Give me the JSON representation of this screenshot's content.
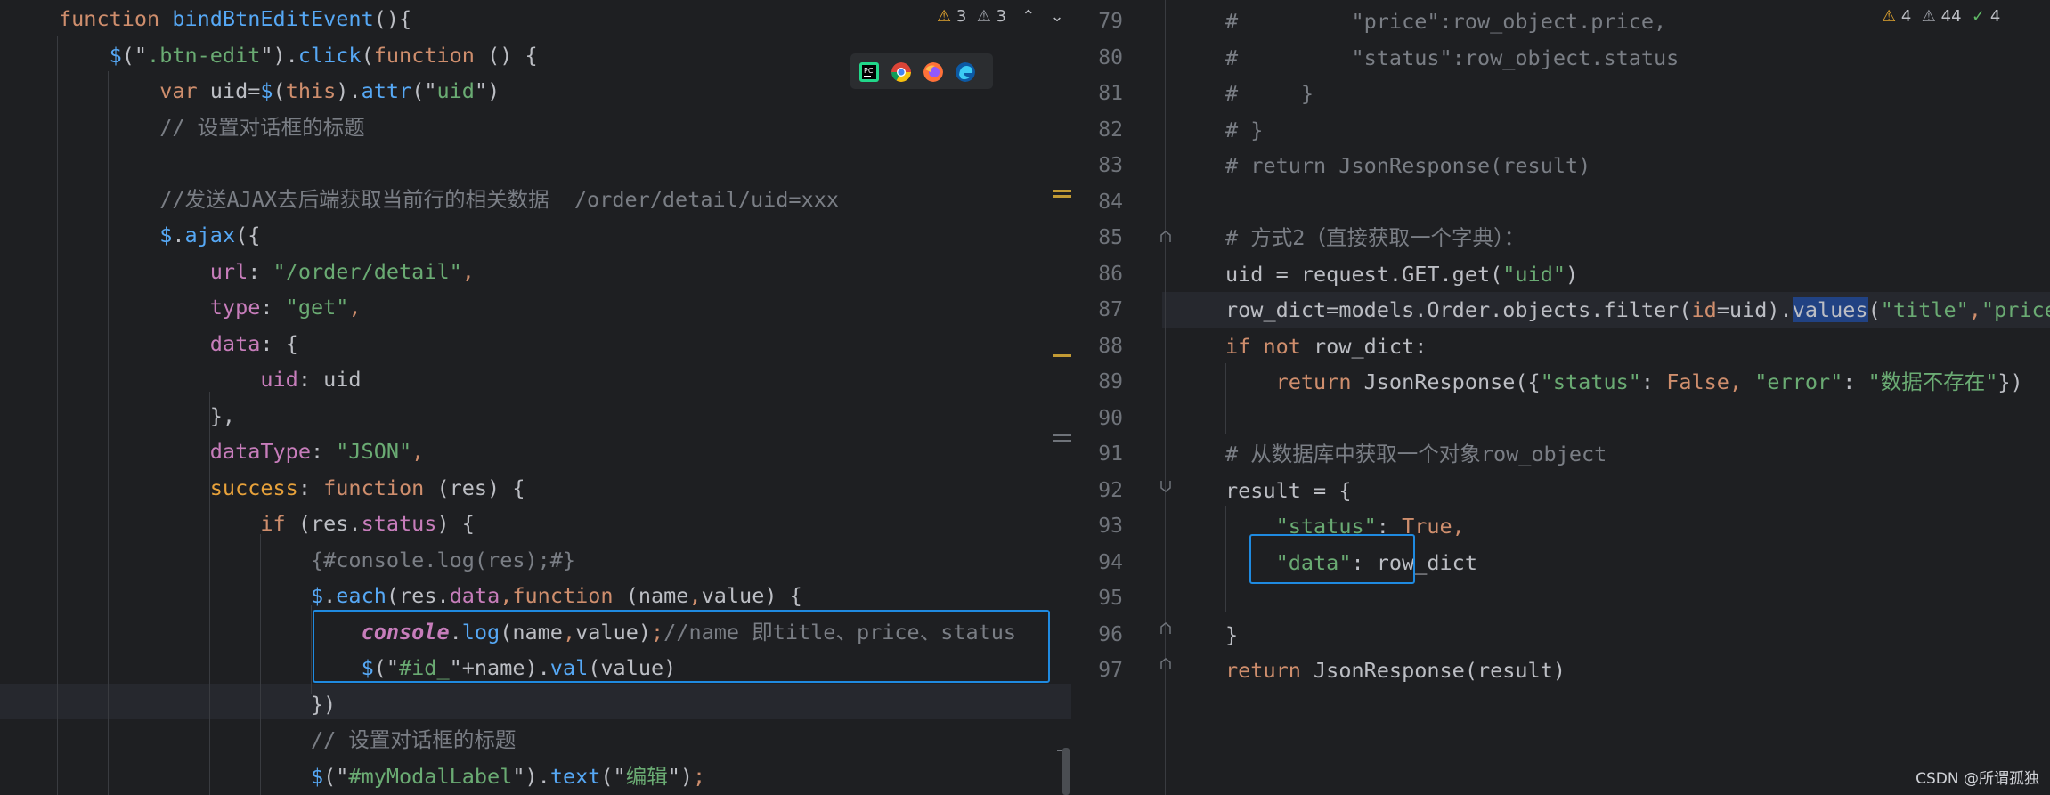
{
  "left_editor": {
    "inspections": {
      "warnings": "3",
      "weak_warnings": "3",
      "up_arrow": "⌃",
      "down_arrow": "⌄"
    },
    "browser_icons": [
      "pycharm-icon",
      "chrome-icon",
      "firefox-icon",
      "edge-icon"
    ],
    "lines": [
      {
        "tokens": [
          {
            "c": "kw",
            "t": "function "
          },
          {
            "c": "fn",
            "t": "bindBtnEditEvent"
          },
          {
            "c": "plain",
            "t": "(){"
          }
        ]
      },
      {
        "tokens": [
          {
            "c": "plain",
            "t": "    "
          },
          {
            "c": "fn",
            "t": "$"
          },
          {
            "c": "plain",
            "t": "(\""
          },
          {
            "c": "str",
            "t": ".btn-edit"
          },
          {
            "c": "plain",
            "t": "\")."
          },
          {
            "c": "fn",
            "t": "click"
          },
          {
            "c": "plain",
            "t": "("
          },
          {
            "c": "kw",
            "t": "function"
          },
          {
            "c": "plain",
            "t": " () {"
          }
        ]
      },
      {
        "tokens": [
          {
            "c": "plain",
            "t": "        "
          },
          {
            "c": "kw",
            "t": "var"
          },
          {
            "c": "plain",
            "t": " uid="
          },
          {
            "c": "fn",
            "t": "$"
          },
          {
            "c": "plain",
            "t": "("
          },
          {
            "c": "kw",
            "t": "this"
          },
          {
            "c": "plain",
            "t": ")."
          },
          {
            "c": "fn",
            "t": "attr"
          },
          {
            "c": "plain",
            "t": "(\""
          },
          {
            "c": "str",
            "t": "uid"
          },
          {
            "c": "plain",
            "t": "\")"
          }
        ]
      },
      {
        "tokens": [
          {
            "c": "plain",
            "t": "        "
          },
          {
            "c": "cm",
            "t": "// 设置对话框的标题"
          }
        ]
      },
      {
        "tokens": []
      },
      {
        "tokens": [
          {
            "c": "plain",
            "t": "        "
          },
          {
            "c": "cm",
            "t": "//发送AJAX去后端获取当前行的相关数据  /order/detail/uid=xxx"
          }
        ]
      },
      {
        "tokens": [
          {
            "c": "plain",
            "t": "        "
          },
          {
            "c": "fn",
            "t": "$"
          },
          {
            "c": "plain",
            "t": "."
          },
          {
            "c": "fn",
            "t": "ajax"
          },
          {
            "c": "plain",
            "t": "({"
          }
        ]
      },
      {
        "tokens": [
          {
            "c": "plain",
            "t": "            "
          },
          {
            "c": "prop",
            "t": "url"
          },
          {
            "c": "plain",
            "t": ": "
          },
          {
            "c": "str",
            "t": "\"/order/detail\""
          },
          {
            "c": "kw",
            "t": ","
          }
        ]
      },
      {
        "tokens": [
          {
            "c": "plain",
            "t": "            "
          },
          {
            "c": "prop",
            "t": "type"
          },
          {
            "c": "plain",
            "t": ": "
          },
          {
            "c": "str",
            "t": "\"get\""
          },
          {
            "c": "kw",
            "t": ","
          }
        ]
      },
      {
        "tokens": [
          {
            "c": "plain",
            "t": "            "
          },
          {
            "c": "prop",
            "t": "data"
          },
          {
            "c": "plain",
            "t": ": {"
          }
        ]
      },
      {
        "tokens": [
          {
            "c": "plain",
            "t": "                "
          },
          {
            "c": "prop",
            "t": "uid"
          },
          {
            "c": "plain",
            "t": ": uid"
          }
        ]
      },
      {
        "tokens": [
          {
            "c": "plain",
            "t": "            },"
          }
        ]
      },
      {
        "tokens": [
          {
            "c": "plain",
            "t": "            "
          },
          {
            "c": "prop",
            "t": "dataType"
          },
          {
            "c": "plain",
            "t": ": "
          },
          {
            "c": "str",
            "t": "\"JSON\""
          },
          {
            "c": "kw",
            "t": ","
          }
        ]
      },
      {
        "tokens": [
          {
            "c": "plain",
            "t": "            "
          },
          {
            "c": "yel",
            "t": "success"
          },
          {
            "c": "plain",
            "t": ": "
          },
          {
            "c": "kw",
            "t": "function"
          },
          {
            "c": "plain",
            "t": " (res) {"
          }
        ]
      },
      {
        "tokens": [
          {
            "c": "plain",
            "t": "                "
          },
          {
            "c": "kw",
            "t": "if"
          },
          {
            "c": "plain",
            "t": " (res."
          },
          {
            "c": "prop",
            "t": "status"
          },
          {
            "c": "plain",
            "t": ") {"
          }
        ]
      },
      {
        "tokens": [
          {
            "c": "plain",
            "t": "                    "
          },
          {
            "c": "cm",
            "t": "{#console.log(res);#}"
          }
        ]
      },
      {
        "tokens": [
          {
            "c": "plain",
            "t": "                    "
          },
          {
            "c": "fn",
            "t": "$"
          },
          {
            "c": "plain",
            "t": "."
          },
          {
            "c": "fn",
            "t": "each"
          },
          {
            "c": "plain",
            "t": "(res."
          },
          {
            "c": "prop",
            "t": "data"
          },
          {
            "c": "kw",
            "t": ","
          },
          {
            "c": "kw",
            "t": "function"
          },
          {
            "c": "plain",
            "t": " (name"
          },
          {
            "c": "kw",
            "t": ","
          },
          {
            "c": "plain",
            "t": "value) {"
          }
        ]
      },
      {
        "tokens": [
          {
            "c": "plain",
            "t": "                        "
          },
          {
            "c": "ital",
            "t": "console"
          },
          {
            "c": "plain",
            "t": "."
          },
          {
            "c": "fn",
            "t": "log"
          },
          {
            "c": "plain",
            "t": "(name"
          },
          {
            "c": "kw",
            "t": ","
          },
          {
            "c": "plain",
            "t": "value)"
          },
          {
            "c": "kw",
            "t": ";"
          },
          {
            "c": "cm",
            "t": "//name 即title、price、status"
          }
        ]
      },
      {
        "tokens": [
          {
            "c": "plain",
            "t": "                        "
          },
          {
            "c": "fn",
            "t": "$"
          },
          {
            "c": "plain",
            "t": "(\""
          },
          {
            "c": "str",
            "t": "#id_"
          },
          {
            "c": "plain",
            "t": "\"+name)."
          },
          {
            "c": "fn",
            "t": "val"
          },
          {
            "c": "plain",
            "t": "(value)"
          }
        ]
      },
      {
        "tokens": [
          {
            "c": "plain",
            "t": "                    })"
          }
        ]
      },
      {
        "tokens": [
          {
            "c": "plain",
            "t": "                    "
          },
          {
            "c": "cm",
            "t": "// 设置对话框的标题"
          }
        ]
      },
      {
        "tokens": [
          {
            "c": "plain",
            "t": "                    "
          },
          {
            "c": "fn",
            "t": "$"
          },
          {
            "c": "plain",
            "t": "(\""
          },
          {
            "c": "str",
            "t": "#myModalLabel"
          },
          {
            "c": "plain",
            "t": "\")."
          },
          {
            "c": "fn",
            "t": "text"
          },
          {
            "c": "plain",
            "t": "(\""
          },
          {
            "c": "str",
            "t": "编辑"
          },
          {
            "c": "plain",
            "t": "\")"
          },
          {
            "c": "kw",
            "t": ";"
          }
        ]
      }
    ]
  },
  "right_editor": {
    "inspections": {
      "warnings": "4",
      "weak_warnings": "44",
      "typos": "4"
    },
    "lines": [
      {
        "num": "79",
        "tokens": [
          {
            "c": "cm",
            "t": "#         \"price\":row_object.price,"
          }
        ]
      },
      {
        "num": "80",
        "tokens": [
          {
            "c": "cm",
            "t": "#         \"status\":row_object.status"
          }
        ]
      },
      {
        "num": "81",
        "tokens": [
          {
            "c": "cm",
            "t": "#     }"
          }
        ]
      },
      {
        "num": "82",
        "tokens": [
          {
            "c": "cm",
            "t": "# }"
          }
        ]
      },
      {
        "num": "83",
        "tokens": [
          {
            "c": "cm",
            "t": "# return JsonResponse(result)"
          }
        ]
      },
      {
        "num": "84",
        "tokens": []
      },
      {
        "num": "85",
        "tokens": [
          {
            "c": "cm",
            "t": "# 方式2（直接获取一个字典）："
          }
        ]
      },
      {
        "num": "86",
        "tokens": [
          {
            "c": "plain",
            "t": "uid = request.GET.get("
          },
          {
            "c": "str",
            "t": "\"uid\""
          },
          {
            "c": "plain",
            "t": ")"
          }
        ]
      },
      {
        "num": "87",
        "tokens": [
          {
            "c": "plain",
            "t": "row_dict=models.Order.objects.filter("
          },
          {
            "c": "kw",
            "t": "id"
          },
          {
            "c": "plain",
            "t": "=uid)."
          },
          {
            "c": "sel",
            "t": "values"
          },
          {
            "c": "plain",
            "t": "("
          },
          {
            "c": "str",
            "t": "\"title\""
          },
          {
            "c": "kw",
            "t": ","
          },
          {
            "c": "str",
            "t": "\"price\""
          }
        ]
      },
      {
        "num": "88",
        "tokens": [
          {
            "c": "kw",
            "t": "if not"
          },
          {
            "c": "plain",
            "t": " row_dict:"
          }
        ]
      },
      {
        "num": "89",
        "tokens": [
          {
            "c": "plain",
            "t": "    "
          },
          {
            "c": "kw",
            "t": "return"
          },
          {
            "c": "plain",
            "t": " JsonResponse({"
          },
          {
            "c": "str",
            "t": "\"status\""
          },
          {
            "c": "plain",
            "t": ": "
          },
          {
            "c": "kw",
            "t": "False"
          },
          {
            "c": "kw",
            "t": ", "
          },
          {
            "c": "str",
            "t": "\"error\""
          },
          {
            "c": "plain",
            "t": ": "
          },
          {
            "c": "str",
            "t": "\"数据不存在\""
          },
          {
            "c": "plain",
            "t": "})"
          }
        ]
      },
      {
        "num": "90",
        "tokens": []
      },
      {
        "num": "91",
        "tokens": [
          {
            "c": "cm",
            "t": "# 从数据库中获取一个对象row_object"
          }
        ]
      },
      {
        "num": "92",
        "tokens": [
          {
            "c": "plain",
            "t": "result = {"
          }
        ]
      },
      {
        "num": "93",
        "tokens": [
          {
            "c": "plain",
            "t": "    "
          },
          {
            "c": "str",
            "t": "\"status\""
          },
          {
            "c": "plain",
            "t": ": "
          },
          {
            "c": "kw",
            "t": "True"
          },
          {
            "c": "kw",
            "t": ","
          }
        ]
      },
      {
        "num": "94",
        "tokens": [
          {
            "c": "plain",
            "t": "    "
          },
          {
            "c": "str",
            "t": "\"data\""
          },
          {
            "c": "plain",
            "t": ": row_dict"
          }
        ]
      },
      {
        "num": "95",
        "tokens": []
      },
      {
        "num": "96",
        "tokens": [
          {
            "c": "plain",
            "t": "}"
          }
        ]
      },
      {
        "num": "97",
        "tokens": [
          {
            "c": "kw",
            "t": "return"
          },
          {
            "c": "plain",
            "t": " JsonResponse(result)"
          }
        ]
      }
    ]
  },
  "watermark": "CSDN @所谓孤独",
  "colors": {
    "highlight_box": "#1f8ae0",
    "background": "#1e1f22",
    "current_line": "#26282e",
    "selection": "#214283"
  }
}
